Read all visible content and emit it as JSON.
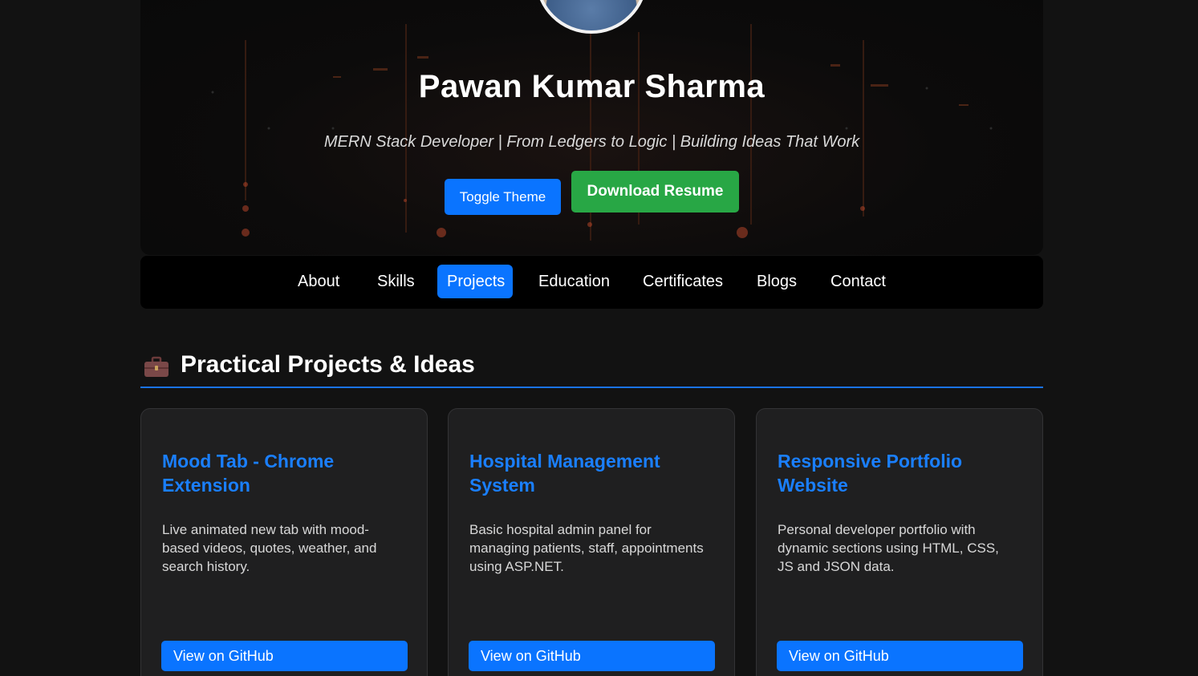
{
  "hero": {
    "name": "Pawan Kumar Sharma",
    "tagline": "MERN Stack Developer | From Ledgers to Logic | Building Ideas That Work",
    "toggle_theme_label": "Toggle Theme",
    "download_resume_label": "Download Resume"
  },
  "nav": {
    "items": [
      {
        "label": "About"
      },
      {
        "label": "Skills"
      },
      {
        "label": "Projects"
      },
      {
        "label": "Education"
      },
      {
        "label": "Certificates"
      },
      {
        "label": "Blogs"
      },
      {
        "label": "Contact"
      }
    ],
    "active": "Projects"
  },
  "projects_section": {
    "icon": "briefcase-icon",
    "title": "Practical Projects & Ideas"
  },
  "projects": [
    {
      "title": "Mood Tab - Chrome Extension",
      "description": "Live animated new tab with mood-based videos, quotes, weather, and search history.",
      "button_label": "View on GitHub"
    },
    {
      "title": "Hospital Management System",
      "description": "Basic hospital admin panel for managing patients, staff, appointments using ASP.NET.",
      "button_label": "View on GitHub"
    },
    {
      "title": "Responsive Portfolio Website",
      "description": "Personal developer portfolio with dynamic sections using HTML, CSS, JS and JSON data.",
      "button_label": "View on GitHub"
    }
  ],
  "colors": {
    "page_bg": "#121212",
    "accent_blue": "#0a74ff",
    "link_blue": "#1a7fff",
    "resume_green": "#28a745",
    "card_bg": "#1f1f20"
  }
}
